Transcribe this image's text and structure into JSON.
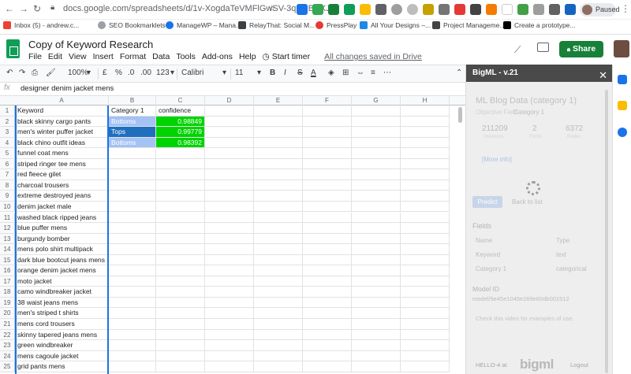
{
  "browser": {
    "url": "docs.google.com/spreadsheets/d/1v-XogdaTeVMFlGwSV-3qNBBjcXJ...",
    "profile_status": "Paused",
    "bookmarks": [
      {
        "label": "Inbox (5) - andrew.c...",
        "color": "#ea4335"
      },
      {
        "label": "SEO Bookmarklets",
        "color": "#9aa0a6"
      },
      {
        "label": "ManageWP – Mana...",
        "color": "#1a73e8"
      },
      {
        "label": "RelayThat: Social M...",
        "color": "#3c4043"
      },
      {
        "label": "PressPlay",
        "color": "#e53935"
      },
      {
        "label": "All Your Designs –...",
        "color": "#1e88e5"
      },
      {
        "label": "Project Manageme...",
        "color": "#424242"
      },
      {
        "label": "Create a prototype...",
        "color": "#000000"
      }
    ]
  },
  "sheets": {
    "title": "Copy of Keyword Research",
    "menu": [
      "File",
      "Edit",
      "View",
      "Insert",
      "Format",
      "Data",
      "Tools",
      "Add-ons",
      "Help"
    ],
    "start_timer": "Start timer",
    "save_status": "All changes saved in Drive",
    "share_label": "Share",
    "toolbar": {
      "zoom": "100%",
      "currency": "£",
      "percent": "%",
      "dec_less": ".0",
      "dec_more": ".00",
      "format_more": "123",
      "font": "Calibri",
      "font_size": "11",
      "bold": "B",
      "italic": "I",
      "strike": "S",
      "text_color": "A"
    },
    "formula_bar": {
      "fx": "fx",
      "value": "designer denim jacket mens"
    },
    "columns": [
      "A",
      "B",
      "C",
      "D",
      "E",
      "F",
      "G",
      "H"
    ],
    "rows": [
      {
        "n": "1",
        "a": "Keyword",
        "b": "Category 1",
        "c": "confidence"
      },
      {
        "n": "2",
        "a": "black skinny cargo pants",
        "b": "Bottoms",
        "c": "0.98849"
      },
      {
        "n": "3",
        "a": "men's winter puffer jacket",
        "b": "Tops",
        "c": "0.99779"
      },
      {
        "n": "4",
        "a": "black chino outfit ideas",
        "b": "Bottoms",
        "c": "0.98392"
      },
      {
        "n": "5",
        "a": "funnel coat mens",
        "b": "",
        "c": ""
      },
      {
        "n": "6",
        "a": "striped ringer tee mens",
        "b": "",
        "c": ""
      },
      {
        "n": "7",
        "a": "red fleece gilet",
        "b": "",
        "c": ""
      },
      {
        "n": "8",
        "a": "charcoal trousers",
        "b": "",
        "c": ""
      },
      {
        "n": "9",
        "a": "extreme destroyed jeans",
        "b": "",
        "c": ""
      },
      {
        "n": "10",
        "a": "denim jacket male",
        "b": "",
        "c": ""
      },
      {
        "n": "11",
        "a": "washed black ripped jeans",
        "b": "",
        "c": ""
      },
      {
        "n": "12",
        "a": "blue puffer mens",
        "b": "",
        "c": ""
      },
      {
        "n": "13",
        "a": "burgundy bomber",
        "b": "",
        "c": ""
      },
      {
        "n": "14",
        "a": "mens polo shirt multipack",
        "b": "",
        "c": ""
      },
      {
        "n": "15",
        "a": "dark blue bootcut jeans mens",
        "b": "",
        "c": ""
      },
      {
        "n": "16",
        "a": "orange denim jacket mens",
        "b": "",
        "c": ""
      },
      {
        "n": "17",
        "a": "moto jacket",
        "b": "",
        "c": ""
      },
      {
        "n": "18",
        "a": "camo windbreaker jacket",
        "b": "",
        "c": ""
      },
      {
        "n": "19",
        "a": "38 waist jeans mens",
        "b": "",
        "c": ""
      },
      {
        "n": "20",
        "a": "men's striped t shirts",
        "b": "",
        "c": ""
      },
      {
        "n": "21",
        "a": "mens cord trousers",
        "b": "",
        "c": ""
      },
      {
        "n": "22",
        "a": "skinny tapered jeans mens",
        "b": "",
        "c": ""
      },
      {
        "n": "23",
        "a": "green windbreaker",
        "b": "",
        "c": ""
      },
      {
        "n": "24",
        "a": "mens cagoule jacket",
        "b": "",
        "c": ""
      },
      {
        "n": "25",
        "a": "grid pants mens",
        "b": "",
        "c": ""
      }
    ],
    "highlight_colors": {
      "bottoms": "#a4c2f4",
      "tops": "#1f6fbf",
      "confidence": "#00d400"
    }
  },
  "bigml": {
    "panel_title": "BigML - v.21",
    "model_title": "ML Blog Data (category 1)",
    "objective_field_label": "Objective Field",
    "objective_field_value": "Category 1",
    "stats": [
      "211209",
      "2",
      "6372"
    ],
    "stat_labels": [
      "Instances",
      "Fields",
      "Nodes"
    ],
    "more_info": "[More info]",
    "predict_label": "Predict",
    "back_label": "Back to list",
    "fields_heading": "Fields",
    "fields_col_name": "Name",
    "fields_col_type": "Type",
    "fields": [
      {
        "name": "Keyword",
        "type": "text"
      },
      {
        "name": "Category 1",
        "type": "categorical"
      }
    ],
    "model_id_label": "Model ID",
    "model_id_value": "model/5e45e1045e269e60db001512",
    "video_text": "Check this video for examples of use.",
    "footer_user": "HELLO-4 at",
    "footer_logo": "bigml",
    "logout": "Logout"
  }
}
